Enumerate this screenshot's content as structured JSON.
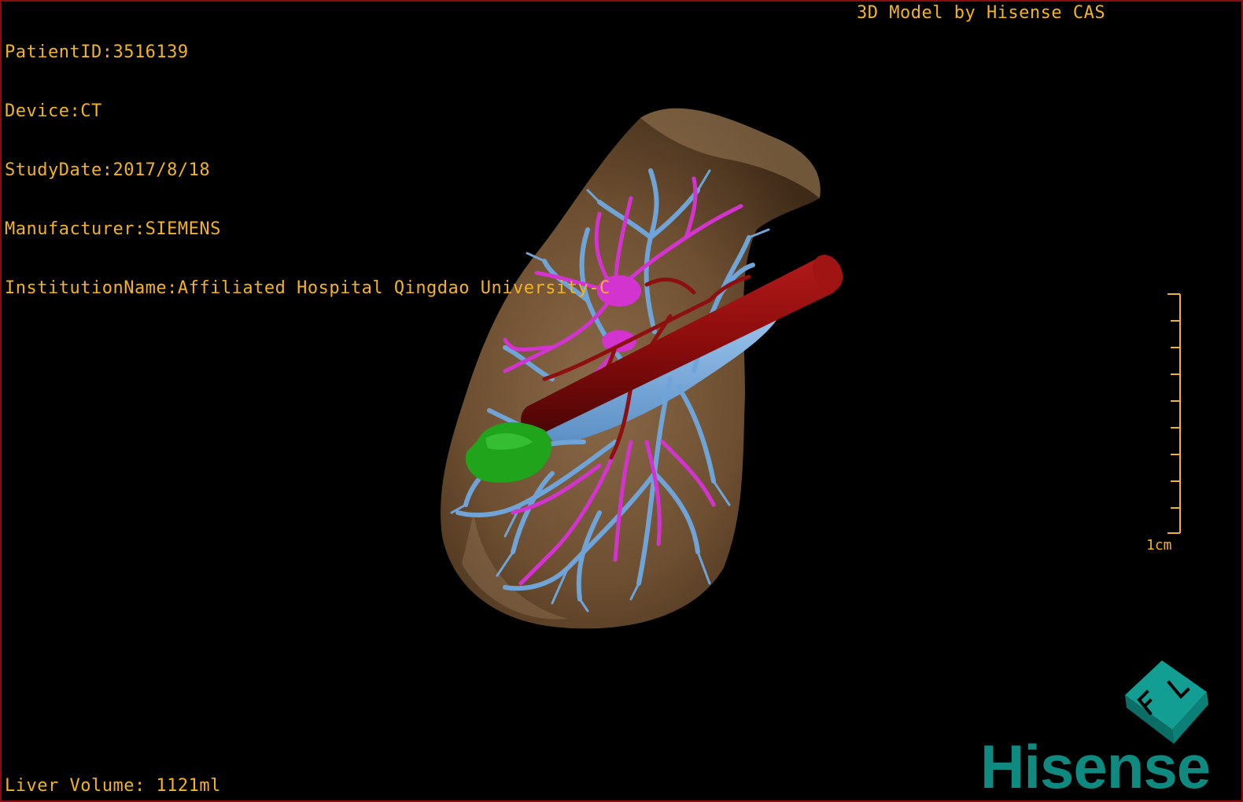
{
  "patient_info": {
    "patient_id": "PatientID:3516139",
    "device": "Device:CT",
    "study_date": "StudyDate:2017/8/18",
    "manufacturer": "Manufacturer:SIEMENS",
    "institution": "InstitutionName:Affiliated Hospital Qingdao University-C"
  },
  "model_credit": "3D Model by Hisense CAS",
  "liver_volume": "Liver Volume: 1121ml",
  "scale_bar": {
    "label": "1cm"
  },
  "orientation_cube": {
    "face_letters": [
      "F",
      "L"
    ]
  },
  "logo": {
    "text": "Hisense",
    "color": "#0e8a80"
  },
  "colors": {
    "overlay_text": "#f2b420",
    "border": "#8a0d0d",
    "liver": "#7b5a3a",
    "portal_vein": "#6ea4d8",
    "hepatic_vein": "#d334cf",
    "artery_ivc": "#8e0f0f",
    "lesion": "#1fa41c"
  },
  "icons": [
    "orientation-cube-icon",
    "scale-ruler-icon",
    "hisense-logo"
  ]
}
